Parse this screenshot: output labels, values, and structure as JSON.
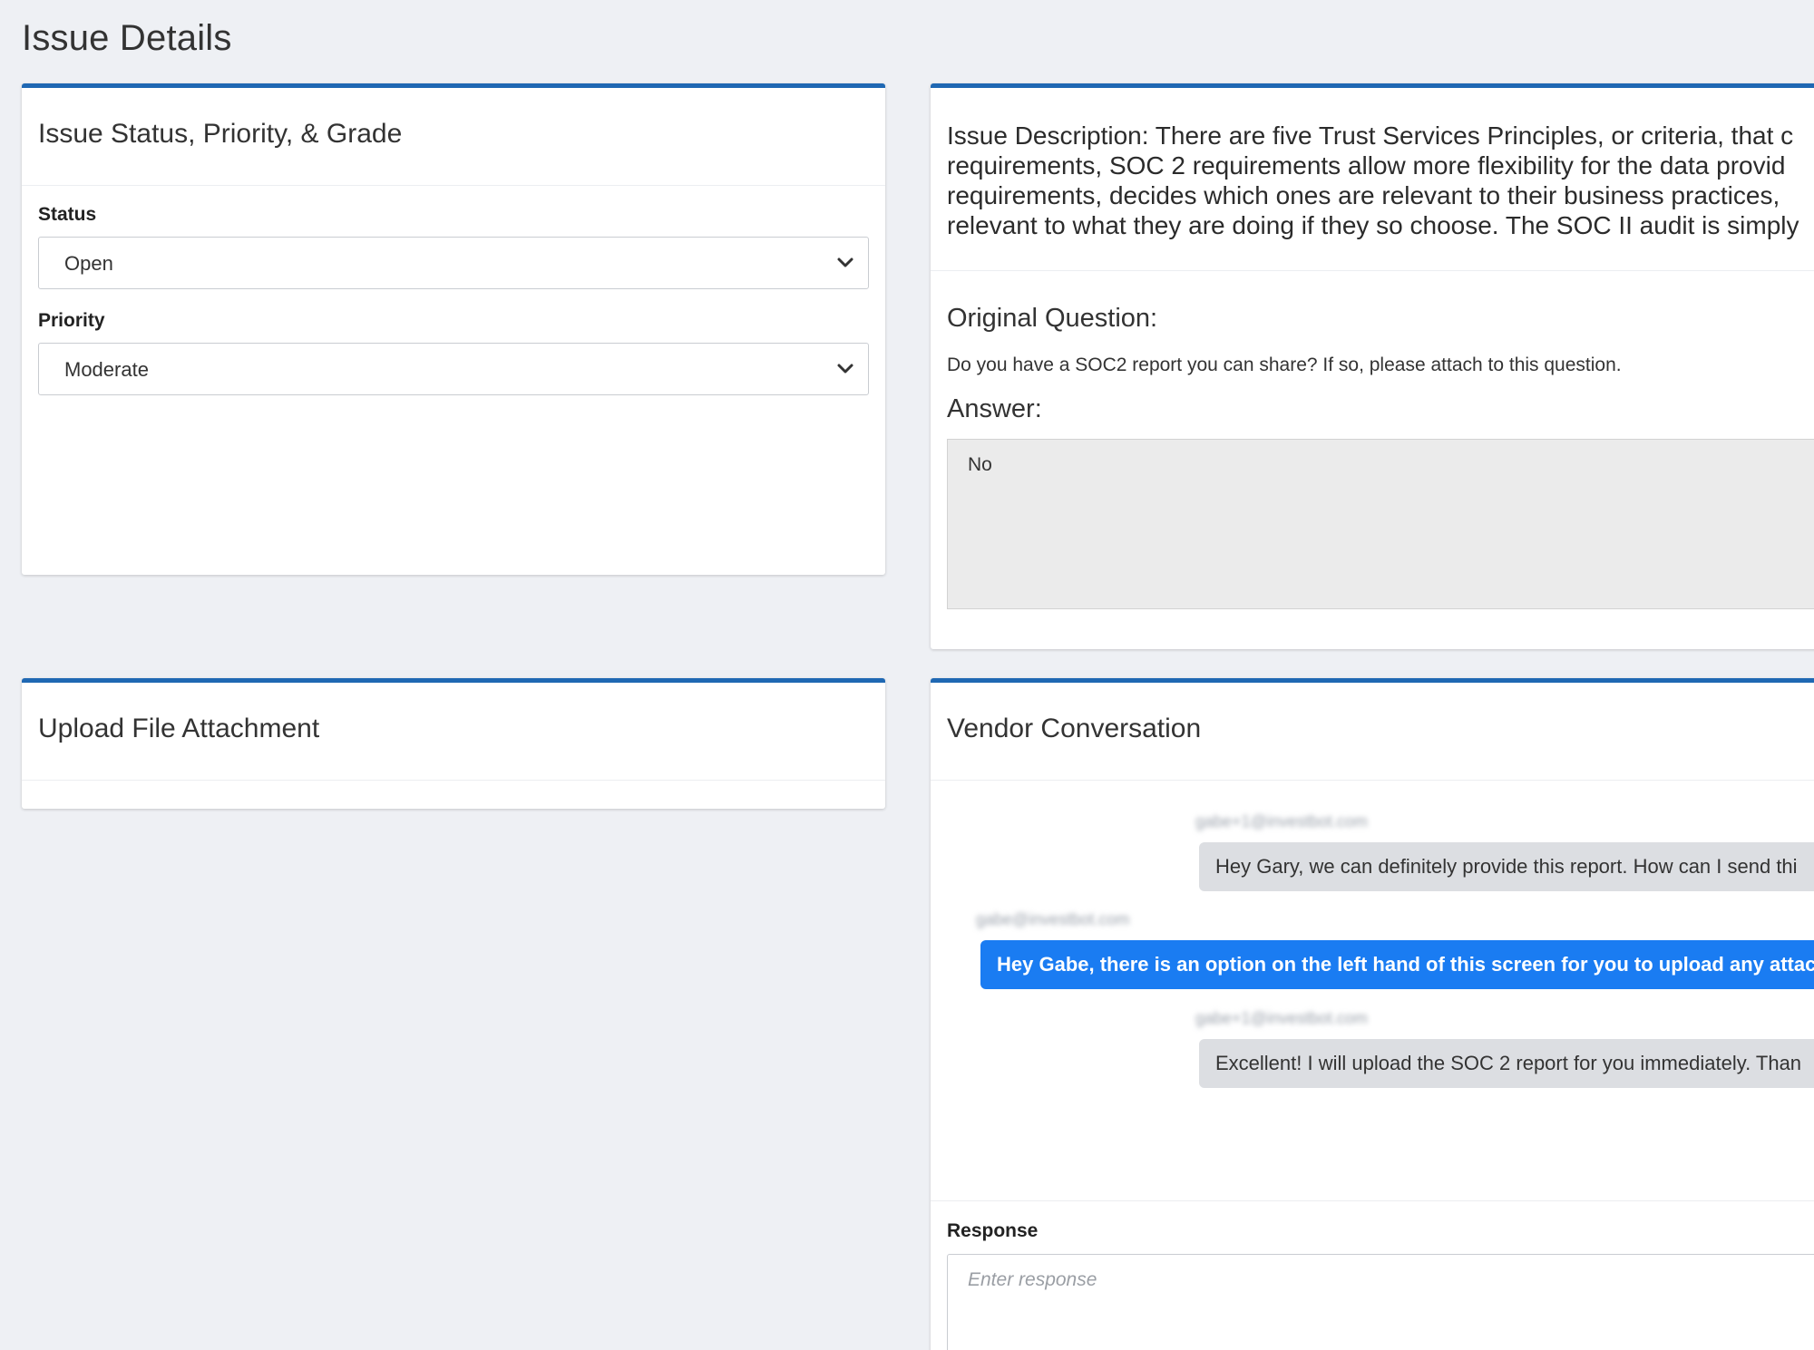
{
  "page": {
    "title": "Issue Details"
  },
  "status_card": {
    "title": "Issue Status, Priority, & Grade",
    "status_label": "Status",
    "status_value": "Open",
    "priority_label": "Priority",
    "priority_value": "Moderate"
  },
  "upload_card": {
    "title": "Upload File Attachment"
  },
  "issue_card": {
    "description_lines": [
      "Issue Description: There are five Trust Services Principles, or criteria, that c",
      "requirements, SOC 2 requirements allow more flexibility for the data provid",
      "requirements, decides which ones are relevant to their business practices,",
      "relevant to what they are doing if they so choose. The SOC II audit is simply"
    ],
    "original_question_label": "Original Question:",
    "original_question_text": "Do you have a SOC2 report you can share? If so, please attach to this question.",
    "answer_label": "Answer:",
    "answer_value": "No"
  },
  "conversation_card": {
    "title": "Vendor Conversation",
    "messages": [
      {
        "sender": "gabe+1@investbot.com",
        "text": "Hey Gary, we can definitely provide this report. How can I send thi"
      },
      {
        "sender": "gabe@investbot.com",
        "text": "Hey Gabe, there is an option on the left hand of this screen for you to upload any attachme"
      },
      {
        "sender": "gabe+1@investbot.com",
        "text": "Excellent! I will upload the SOC 2 report for you immediately. Than"
      }
    ],
    "response_label": "Response",
    "response_placeholder": "Enter response"
  },
  "colors": {
    "accent": "#1f68b3",
    "outgoing_bubble": "#1a7cf2",
    "incoming_bubble": "#dcdee2",
    "background": "#eef0f4"
  },
  "icons": {
    "select_arrow": "chevron-down-icon"
  }
}
